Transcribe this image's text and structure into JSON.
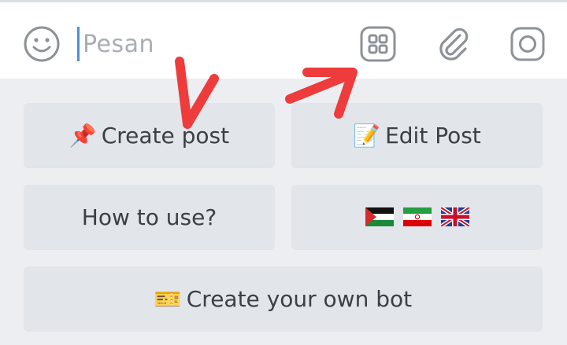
{
  "composer": {
    "placeholder": "Pesan",
    "icons": [
      "smile-icon",
      "bot-menu-grid-icon",
      "paperclip-icon",
      "instagram-icon"
    ]
  },
  "reply_keyboard": {
    "buttons": [
      {
        "emoji": "📌",
        "label": "Create post"
      },
      {
        "emoji": "📝",
        "label": "Edit Post"
      },
      {
        "label": "How to use?"
      },
      {
        "flags": [
          "palestine",
          "iran",
          "united-kingdom"
        ]
      },
      {
        "emoji": "🎫",
        "label": "Create your own bot"
      }
    ]
  },
  "colors": {
    "composer_bg": "#ffffff",
    "keyboard_bg": "#eceef1",
    "button_bg": "#e2e5e9",
    "text": "#3b4045",
    "caret": "#4a90d9",
    "annotation_arrows": "#ee3b3b"
  }
}
